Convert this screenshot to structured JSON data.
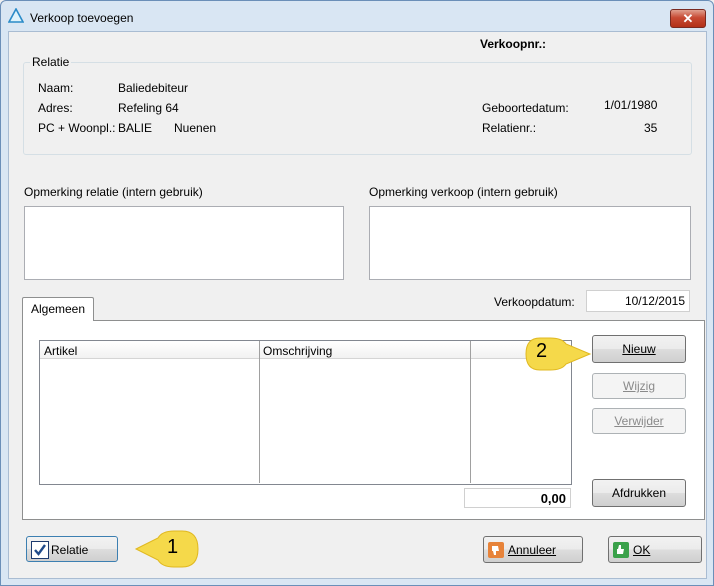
{
  "window": {
    "title": "Verkoop toevoegen",
    "close_label": "✕"
  },
  "header": {
    "verkoopnr_label": "Verkoopnr.:"
  },
  "relatie": {
    "group_title": "Relatie",
    "naam_label": "Naam:",
    "naam_value": "Baliedebiteur",
    "adres_label": "Adres:",
    "adres_value": "Refeling 64",
    "pc_label": "PC + Woonpl.:",
    "pc_value": "BALIE",
    "woonplaats_value": "Nuenen",
    "geboortedatum_label": "Geboortedatum:",
    "geboortedatum_value": "1/01/1980",
    "relatienr_label": "Relatienr.:",
    "relatienr_value": "35"
  },
  "opmerkingen": {
    "relatie_label": "Opmerking relatie (intern gebruik)",
    "verkoop_label": "Opmerking verkoop (intern gebruik)"
  },
  "tabs": [
    {
      "label": "Algemeen"
    }
  ],
  "verkoopdatum": {
    "label": "Verkoopdatum:",
    "value": "10/12/2015"
  },
  "grid": {
    "columns": [
      "Artikel",
      "Omschrijving",
      ""
    ]
  },
  "totaal": {
    "value": "0,00"
  },
  "buttons": {
    "nieuw": "Nieuw",
    "wijzig": "Wijzig",
    "verwijder": "Verwijder",
    "afdrukken": "Afdrukken",
    "relatie": "Relatie",
    "annuleer": "Annuleer",
    "ok": "OK"
  },
  "callouts": {
    "one": "1",
    "two": "2"
  },
  "colors": {
    "callout_fill": "#f5d94a",
    "accent": "#1f5fa8"
  }
}
